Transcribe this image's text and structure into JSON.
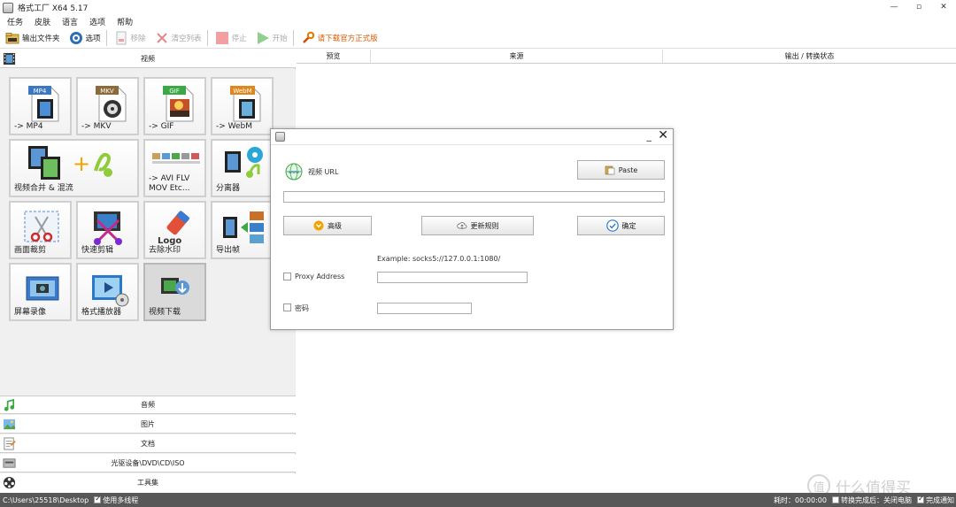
{
  "window": {
    "title": "格式工厂 X64 5.17",
    "controls": [
      "—",
      "▫",
      "✕"
    ]
  },
  "menu": [
    "任务",
    "皮肤",
    "语言",
    "选项",
    "帮助"
  ],
  "toolbar": {
    "output_folder": "输出文件夹",
    "options": "选项",
    "remove": "移除",
    "clear_list": "清空列表",
    "stop": "停止",
    "start": "开始",
    "download_official": "请下载官方正式版"
  },
  "left": {
    "video_section": "视频",
    "tiles": [
      {
        "label": "-> MP4",
        "badge": "MP4"
      },
      {
        "label": "-> MKV",
        "badge": "MKV"
      },
      {
        "label": "-> GIF",
        "badge": "GIF"
      },
      {
        "label": "-> WebM",
        "badge": "WebM"
      },
      {
        "label": "视频合并 & 混流"
      },
      {
        "label": "-> AVI FLV\nMOV Etc..."
      },
      {
        "label": "分离器"
      },
      {
        "label": "画面裁剪"
      },
      {
        "label": "快速剪辑"
      },
      {
        "label": "去除水印",
        "badge": "Logo"
      },
      {
        "label": "导出帧"
      },
      {
        "label": "屏幕录像"
      },
      {
        "label": "格式播放器"
      },
      {
        "label": "视频下载"
      }
    ],
    "sections": [
      "音频",
      "图片",
      "文档",
      "光驱设备\\DVD\\CD\\ISO",
      "工具集"
    ]
  },
  "right": {
    "columns": [
      "预览",
      "来源",
      "输出 / 转换状态"
    ]
  },
  "dialog": {
    "video_url_label": "视频 URL",
    "paste": "Paste",
    "url_value": "",
    "advanced": "高级",
    "update_rules": "更新规则",
    "ok": "确定",
    "example": "Example: socks5://127.0.0.1:1080/",
    "proxy_label": "Proxy Address",
    "proxy_value": "",
    "password_label": "密码",
    "password_value": ""
  },
  "status": {
    "path": "C:\\Users\\25518\\Desktop",
    "multithread": "使用多线程",
    "elapsed": "耗时：00:00:00",
    "after_convert": "转换完成后：关闭电脑",
    "notify": "完成通知"
  },
  "watermark": {
    "text": "什么值得买",
    "glyph": "值"
  },
  "colors": {
    "accent": "#3a7bd5",
    "status_bg": "#585858",
    "download_text": "#e05a00"
  }
}
